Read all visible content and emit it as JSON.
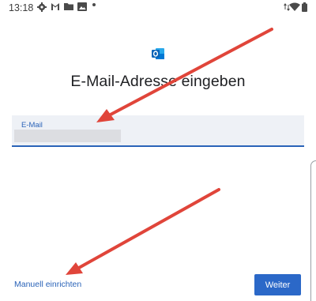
{
  "status_bar": {
    "time": "13:18",
    "icons": [
      "gear-icon",
      "gmail-icon",
      "folder-icon",
      "image-icon",
      "dot-icon",
      "data-arrows-icon",
      "wifi-icon",
      "battery-icon"
    ]
  },
  "app": {
    "logo": "outlook-icon",
    "title": "E-Mail-Adresse eingeben"
  },
  "email_field": {
    "label": "E-Mail",
    "value": ""
  },
  "footer": {
    "manual_setup_link": "Manuell einrichten",
    "next_button": "Weiter"
  },
  "colors": {
    "accent": "#2a63b8",
    "button": "#2b68c8",
    "field_bg": "#eef1f6",
    "arrow": "#e0453a"
  }
}
